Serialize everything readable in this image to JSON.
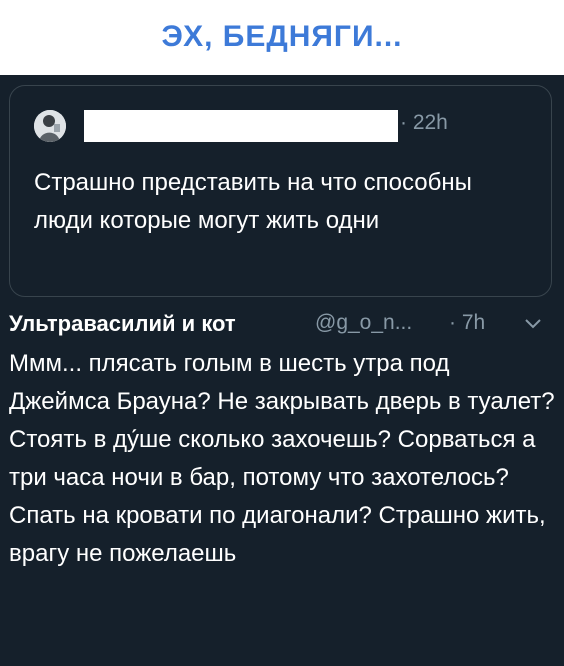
{
  "header": {
    "title": "ЭХ, БЕДНЯГИ...",
    "color": "#3d7ad8"
  },
  "quoted_tweet": {
    "time": "· 22h",
    "text": "Страшно представить на что способны люди которые могут жить одни"
  },
  "reply_tweet": {
    "author_name": "Ультравасилий и кот",
    "handle": "@g_o_n...",
    "time": "· 7h",
    "text": "Ммм... плясать голым в шесть утра под Джеймса Брауна? Не закрывать дверь в туалет? Стоять в ду́ше сколько захочешь? Сорваться а три часа ночи в бар, потому что захотелось? Спать на кровати по диагонали? Страшно жить, врагу не пожелаешь"
  },
  "colors": {
    "background": "#15202b",
    "border": "#38444d",
    "muted_text": "#8899a6",
    "text": "#ffffff"
  },
  "icons": {
    "avatar": "user-avatar",
    "menu": "chevron-down-icon"
  }
}
